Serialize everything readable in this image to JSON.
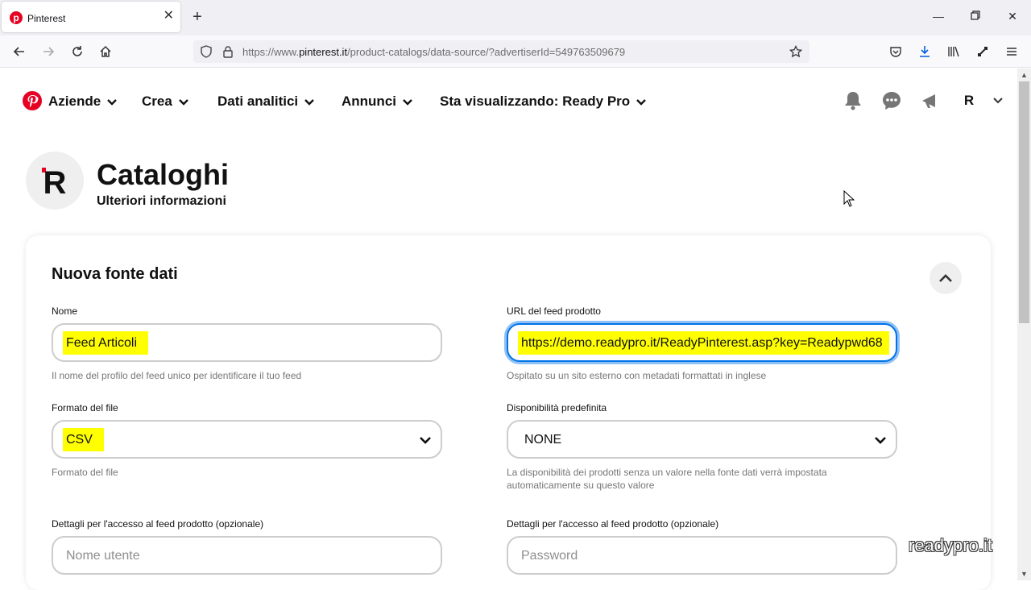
{
  "browser": {
    "tab_title": "Pinterest",
    "url_prefix": "https://www.",
    "url_domain": "pinterest.it",
    "url_path": "/product-catalogs/data-source/?advertiserId=549763509679"
  },
  "header": {
    "menu": [
      {
        "label": "Aziende"
      },
      {
        "label": "Crea"
      },
      {
        "label": "Dati analitici"
      },
      {
        "label": "Annunci"
      },
      {
        "label": "Sta visualizzando: Ready Pro"
      }
    ],
    "user_initial": "R"
  },
  "page": {
    "title": "Cataloghi",
    "subtitle": "Ulteriori informazioni",
    "avatar_letter": "R"
  },
  "form": {
    "card_title": "Nuova fonte dati",
    "name": {
      "label": "Nome",
      "value": "Feed Articoli",
      "help": "Il nome del profilo del feed unico per identificare il tuo feed"
    },
    "url": {
      "label": "URL del feed prodotto",
      "value": "https://demo.readypro.it/ReadyPinterest.asp?key=Readypwd68",
      "help": "Ospitato su un sito esterno con metadati formattati in inglese"
    },
    "format": {
      "label": "Formato del file",
      "value": "CSV",
      "help": "Formato del file"
    },
    "availability": {
      "label": "Disponibilità predefinita",
      "value": "NONE",
      "help": "La disponibilità dei prodotti senza un valore nella fonte dati verrà impostata automaticamente su questo valore"
    },
    "access_user": {
      "label": "Dettagli per l'accesso al feed prodotto (opzionale)",
      "placeholder": "Nome utente"
    },
    "access_password": {
      "label": "Dettagli per l'accesso al feed prodotto (opzionale)",
      "placeholder": "Password"
    }
  },
  "watermark": "readypro.it",
  "colors": {
    "brand": "#e60023",
    "highlight": "#ffff00",
    "focus": "#0074e8"
  }
}
